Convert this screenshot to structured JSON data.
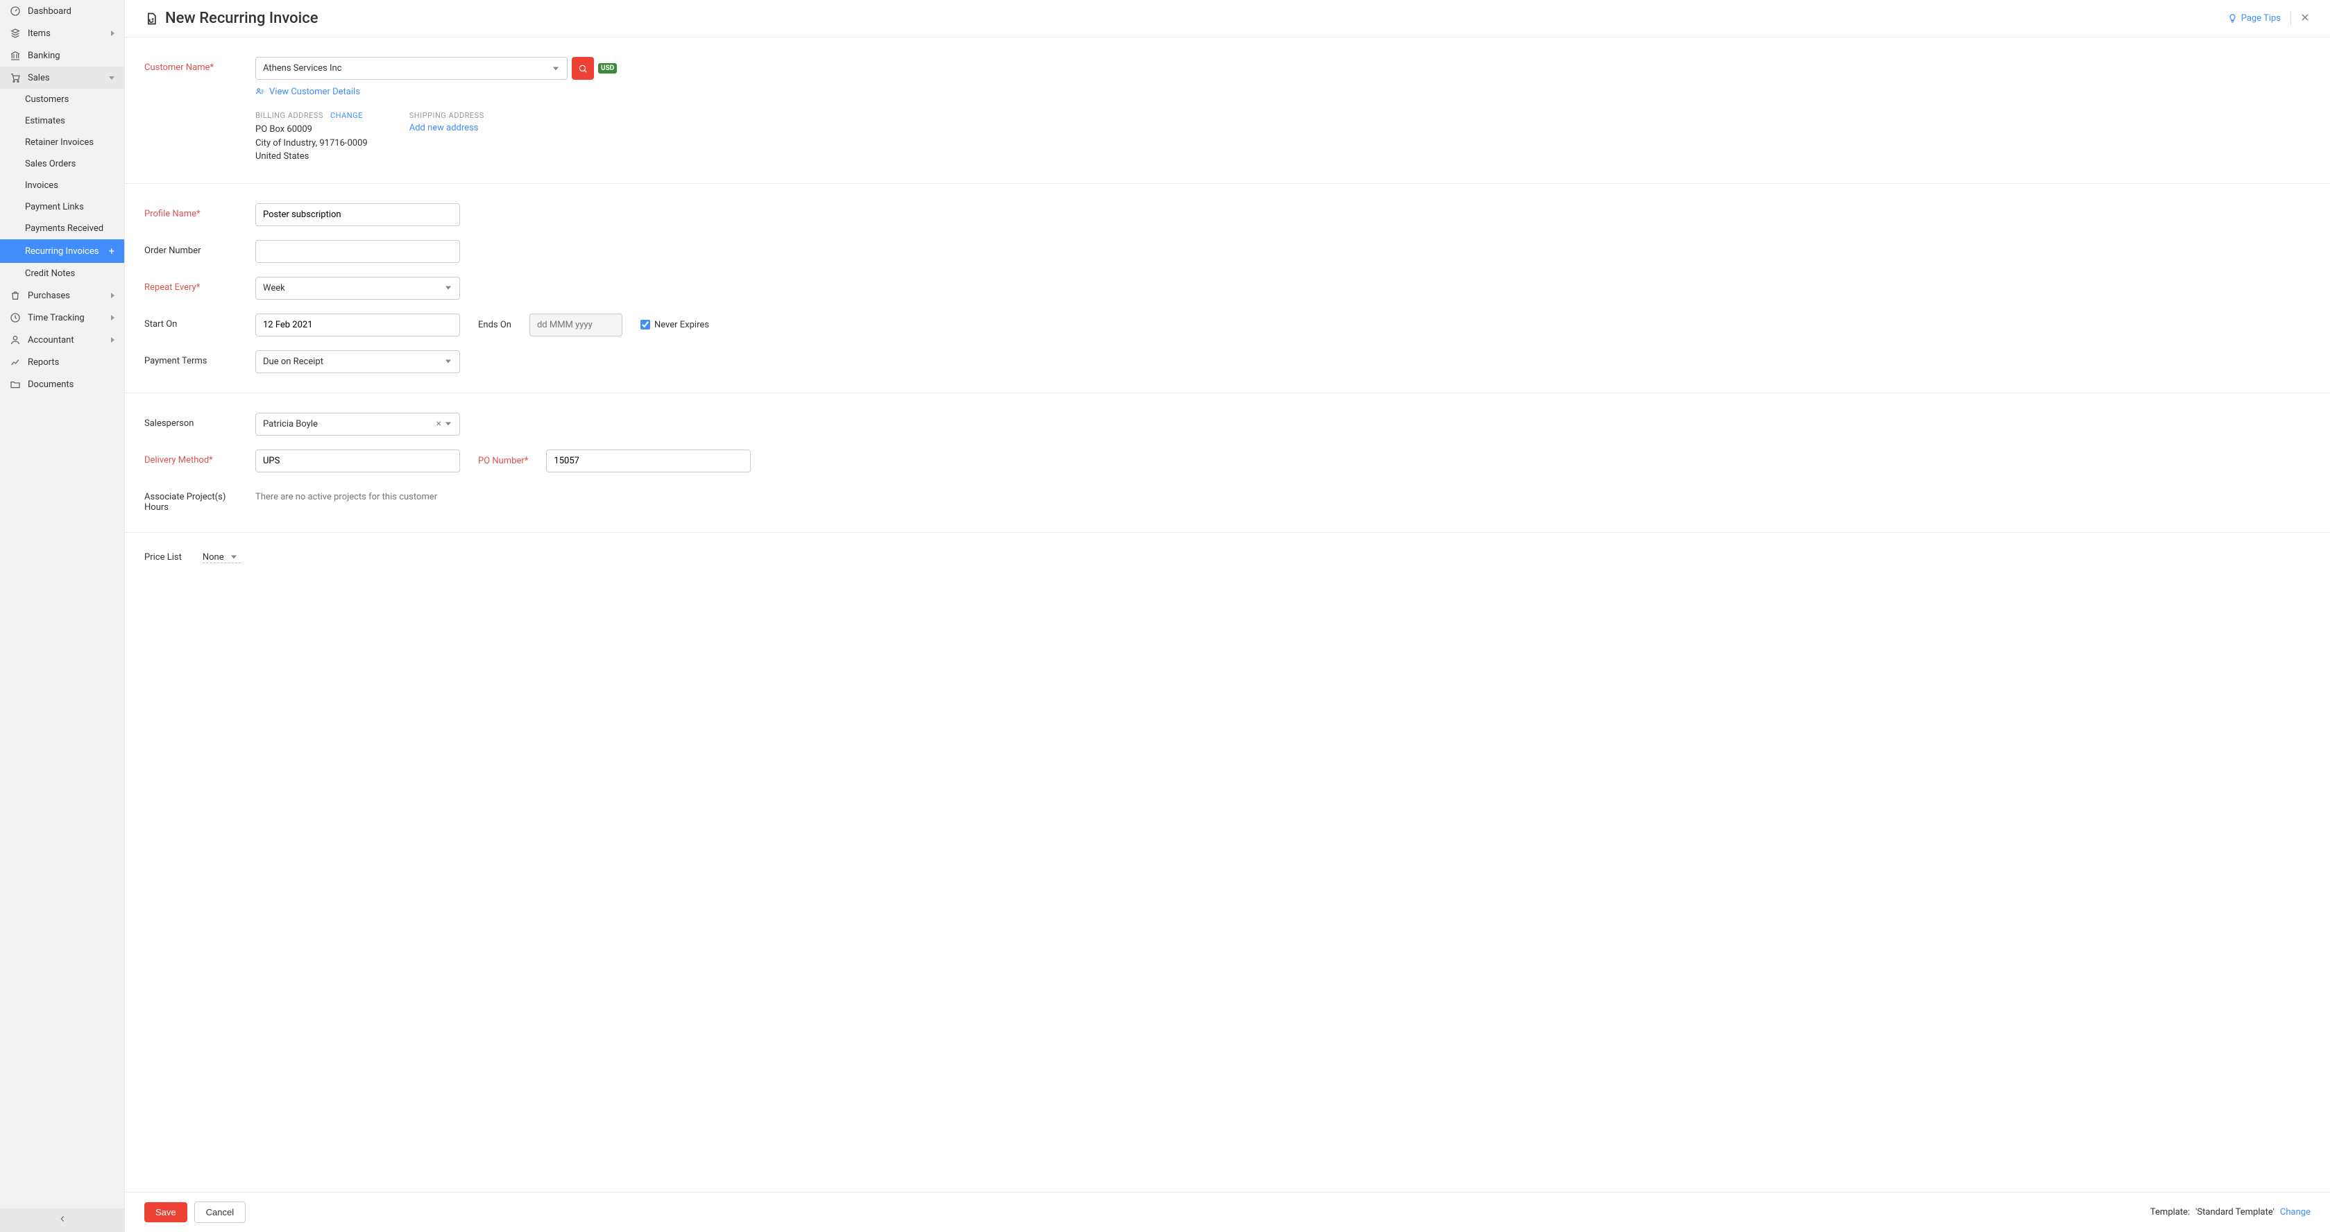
{
  "sidebar": {
    "dashboard": "Dashboard",
    "items": "Items",
    "banking": "Banking",
    "sales": "Sales",
    "sales_children": {
      "customers": "Customers",
      "estimates": "Estimates",
      "retainer_invoices": "Retainer Invoices",
      "sales_orders": "Sales Orders",
      "invoices": "Invoices",
      "payment_links": "Payment Links",
      "payments_received": "Payments Received",
      "recurring_invoices": "Recurring Invoices",
      "credit_notes": "Credit Notes"
    },
    "purchases": "Purchases",
    "time_tracking": "Time Tracking",
    "accountant": "Accountant",
    "reports": "Reports",
    "documents": "Documents"
  },
  "header": {
    "title": "New Recurring Invoice",
    "page_tips": "Page Tips"
  },
  "currency_badge": "USD",
  "form": {
    "customer_name": {
      "label": "Customer Name*",
      "value": "Athens Services Inc",
      "view_details": "View Customer Details"
    },
    "billing": {
      "heading": "BILLING ADDRESS",
      "change": "CHANGE",
      "line1": "PO Box 60009",
      "line2": "City of Industry, 91716-0009",
      "line3": "United States"
    },
    "shipping": {
      "heading": "SHIPPING ADDRESS",
      "add_new": "Add new address"
    },
    "profile_name": {
      "label": "Profile Name*",
      "value": "Poster subscription"
    },
    "order_number": {
      "label": "Order Number",
      "value": ""
    },
    "repeat_every": {
      "label": "Repeat Every*",
      "value": "Week"
    },
    "start_on": {
      "label": "Start On",
      "value": "12 Feb 2021"
    },
    "ends_on": {
      "label": "Ends On",
      "placeholder": "dd MMM yyyy"
    },
    "never_expires": {
      "label": "Never Expires",
      "checked": true
    },
    "payment_terms": {
      "label": "Payment Terms",
      "value": "Due on Receipt"
    },
    "salesperson": {
      "label": "Salesperson",
      "value": "Patricia Boyle"
    },
    "delivery_method": {
      "label": "Delivery Method*",
      "value": "UPS"
    },
    "po_number": {
      "label": "PO Number*",
      "value": "15057"
    },
    "associate_projects": {
      "label_line1": "Associate Project(s)",
      "label_line2": "Hours",
      "empty": "There are no active projects for this customer"
    },
    "price_list": {
      "label": "Price List",
      "value": "None"
    }
  },
  "footer": {
    "save": "Save",
    "cancel": "Cancel",
    "template_label": "Template:",
    "template_name": "'Standard Template'",
    "change": "Change"
  }
}
